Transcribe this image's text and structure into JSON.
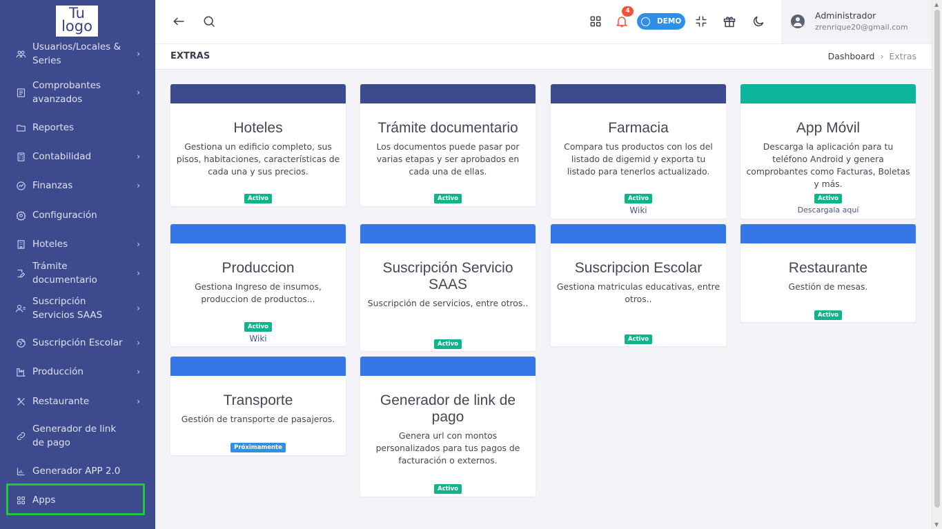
{
  "logo": {
    "line1": "Tu",
    "line2": "logo"
  },
  "sidebar": {
    "items": [
      {
        "label": "Usuarios/Locales & Series",
        "icon": "users-icon",
        "chevron": true
      },
      {
        "label": "Comprobantes avanzados",
        "icon": "receipt-icon",
        "chevron": true
      },
      {
        "label": "Reportes",
        "icon": "folder-icon",
        "chevron": false
      },
      {
        "label": "Contabilidad",
        "icon": "calculator-icon",
        "chevron": true
      },
      {
        "label": "Finanzas",
        "icon": "gauge-icon",
        "chevron": true
      },
      {
        "label": "Configuración",
        "icon": "gear-icon",
        "chevron": false
      },
      {
        "label": "Hoteles",
        "icon": "building-icon",
        "chevron": true
      },
      {
        "label": "Trámite documentario",
        "icon": "edit-icon",
        "chevron": true
      },
      {
        "label": "Suscripción Servicios SAAS",
        "icon": "user-list-icon",
        "chevron": true
      },
      {
        "label": "Suscripción Escolar",
        "icon": "globe-icon",
        "chevron": true
      },
      {
        "label": "Producción",
        "icon": "factory-icon",
        "chevron": true
      },
      {
        "label": "Restaurante",
        "icon": "utensils-icon",
        "chevron": true
      },
      {
        "label": "Generador de link de pago",
        "icon": "link-icon",
        "chevron": false
      },
      {
        "label": "Generador APP 2.0",
        "icon": "chart-icon",
        "chevron": false
      },
      {
        "label": "Apps",
        "icon": "grid-icon",
        "chevron": false
      }
    ]
  },
  "topbar": {
    "notification_count": "4",
    "demo_label": "DEMO",
    "user_name": "Administrador",
    "user_email": "zrenrique20@gmail.com"
  },
  "subheader": {
    "title": "EXTRAS",
    "breadcrumb": [
      "Dashboard",
      "Extras"
    ]
  },
  "colors": {
    "sidebar": "#3d4a8e",
    "band_dark": "#3d4a8e",
    "band_teal": "#0db59a",
    "band_blue": "#3577e6",
    "badge_green": "#0fb58a",
    "badge_blue": "#2f90e4",
    "highlight": "#1ec93b"
  },
  "cards": [
    {
      "title": "Hoteles",
      "desc": "Gestiona un edificio completo, sus pisos, habitaciones, características de cada una y sus precios.",
      "badge": "Activo",
      "link": ""
    },
    {
      "title": "Trámite documentario",
      "desc": "Los documentos puede pasar por varias etapas y ser aprobados en cada una de ellas.",
      "badge": "Activo",
      "link": ""
    },
    {
      "title": "Farmacia",
      "desc": "Compara tus productos con los del listado de digemid y exporta tu listado para tenerlos actualizado.",
      "badge": "Activo",
      "link": "Wiki"
    },
    {
      "title": "App Móvil",
      "desc": "Descarga la aplicación para tu teléfono Android y genera comprobantes como Facturas, Boletas y más.",
      "badge": "Activo",
      "link": "Descargala aquí"
    },
    {
      "title": "Produccion",
      "desc": "Gestiona Ingreso de insumos, produccion de productos...",
      "badge": "Activo",
      "link": "Wiki"
    },
    {
      "title": "Suscripción Servicio SAAS",
      "desc": "Suscripción de servicios, entre otros..",
      "badge": "Activo",
      "link": ""
    },
    {
      "title": "Suscripcion Escolar",
      "desc": "Gestiona matriculas educativas, entre otros..",
      "badge": "Activo",
      "link": ""
    },
    {
      "title": "Restaurante",
      "desc": "Gestión de mesas.",
      "badge": "Activo",
      "link": ""
    },
    {
      "title": "Transporte",
      "desc": "Gestión de transporte de pasajeros.",
      "badge": "Próximamente",
      "link": ""
    },
    {
      "title": "Generador de link de pago",
      "desc": "Genera url con montos personalizados para tus pagos de facturación o externos.",
      "badge": "Activo",
      "link": ""
    }
  ]
}
